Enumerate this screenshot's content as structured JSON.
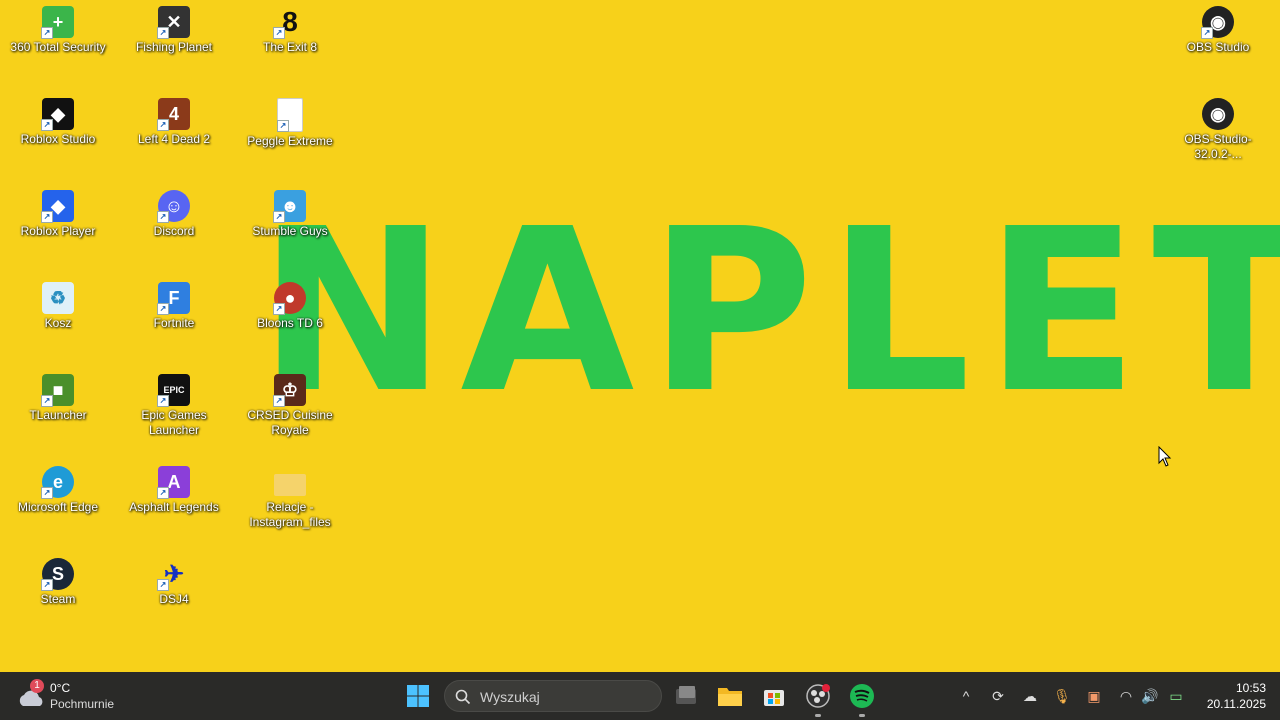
{
  "wallpaper": {
    "text": "NAPLET"
  },
  "desktop_icons": [
    {
      "label": "360 Total Security",
      "glyph": "+",
      "color": "#3bb54a",
      "icon": "shield-plus-icon"
    },
    {
      "label": "Roblox Studio",
      "glyph": "◆",
      "color": "#111111",
      "icon": "roblox-studio-icon"
    },
    {
      "label": "Roblox Player",
      "glyph": "◆",
      "color": "#2563eb",
      "icon": "roblox-player-icon"
    },
    {
      "label": "Kosz",
      "glyph": "♻",
      "color": "#cfe8f5",
      "icon": "recycle-bin-icon"
    },
    {
      "label": "TLauncher",
      "glyph": "■",
      "color": "#4a8f2a",
      "icon": "minecraft-block-icon"
    },
    {
      "label": "Microsoft Edge",
      "glyph": "e",
      "color": "#1f9bd6",
      "icon": "edge-icon"
    },
    {
      "label": "Steam",
      "glyph": "S",
      "color": "#1b2838",
      "icon": "steam-icon"
    },
    {
      "label": "Fishing Planet",
      "glyph": "✕",
      "color": "#333333",
      "icon": "fishing-planet-icon"
    },
    {
      "label": "Left 4 Dead 2",
      "glyph": "4",
      "color": "#8b3a1a",
      "icon": "left4dead-icon"
    },
    {
      "label": "Discord",
      "glyph": "☺",
      "color": "#5865f2",
      "icon": "discord-icon"
    },
    {
      "label": "Fortnite",
      "glyph": "F",
      "color": "#2f7fe0",
      "icon": "fortnite-icon"
    },
    {
      "label": "Epic Games Launcher",
      "glyph": "EPIC",
      "color": "#111111",
      "icon": "epic-games-icon"
    },
    {
      "label": "Asphalt Legends",
      "glyph": "A",
      "color": "#8b3fd9",
      "icon": "asphalt-icon"
    },
    {
      "label": "DSJ4",
      "glyph": "✈",
      "color": "#1530c0",
      "icon": "dsj4-icon"
    },
    {
      "label": "The Exit 8",
      "glyph": "8",
      "color": "#111111",
      "icon": "exit8-icon"
    },
    {
      "label": "Peggle Extreme",
      "glyph": "",
      "color": "#ffffff",
      "icon": "blank-file-icon"
    },
    {
      "label": "Stumble Guys",
      "glyph": "☻",
      "color": "#3aa0e0",
      "icon": "stumble-guys-icon"
    },
    {
      "label": "Bloons TD 6",
      "glyph": "●",
      "color": "#c0392b",
      "icon": "bloons-icon"
    },
    {
      "label": "CRSED Cuisine Royale",
      "glyph": "♔",
      "color": "#5a2a1a",
      "icon": "crsed-icon"
    },
    {
      "label": "Relacje - Instagram_files",
      "glyph": "",
      "color": "#f5d36b",
      "icon": "folder-icon"
    },
    {
      "label": "OBS Studio",
      "glyph": "◉",
      "color": "#222222",
      "icon": "obs-icon"
    },
    {
      "label": "OBS-Studio-32.0.2-...",
      "glyph": "◉",
      "color": "#222222",
      "icon": "obs-installer-icon"
    }
  ],
  "taskbar": {
    "weather": {
      "badge": "1",
      "temp": "0°C",
      "condition": "Pochmurnie"
    },
    "search_placeholder": "Wyszukaj",
    "clock": {
      "time": "10:53",
      "date": "20.11.2025"
    }
  },
  "colors": {
    "wallpaper": "#f7d11a",
    "wallpaper_text": "#2dc64d",
    "taskbar": "#2a2a28",
    "spotify": "#1db954"
  }
}
